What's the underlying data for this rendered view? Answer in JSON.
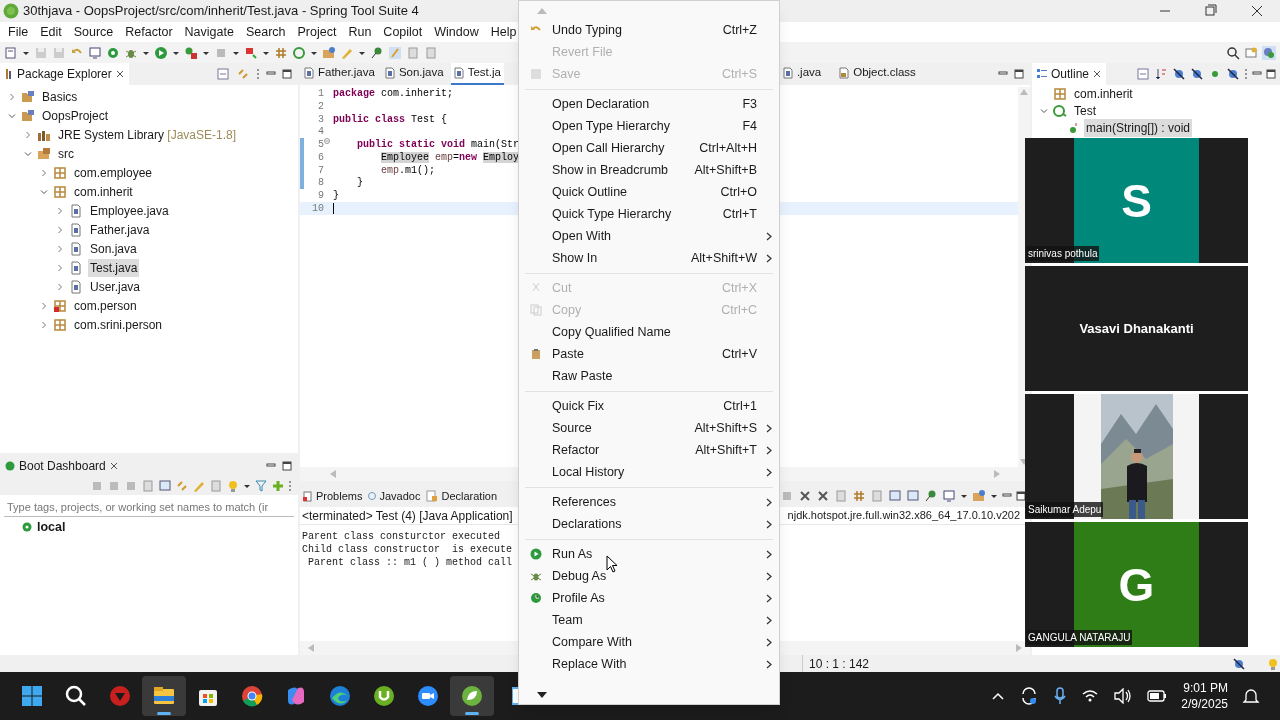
{
  "window": {
    "title": "30thjava - OopsProject/src/com/inherit/Test.java - Spring Tool Suite 4"
  },
  "menu_bar": [
    "File",
    "Edit",
    "Source",
    "Refactor",
    "Navigate",
    "Search",
    "Project",
    "Run",
    "Copilot",
    "Window",
    "Help"
  ],
  "package_explorer": {
    "title": "Package Explorer",
    "tree": [
      {
        "label": "Basics",
        "kind": "project",
        "expanded": false,
        "selected": false
      },
      {
        "label": "OopsProject",
        "kind": "project",
        "expanded": true,
        "selected": false,
        "children": [
          {
            "label": "JRE System Library",
            "decoration": "[JavaSE-1.8]",
            "kind": "library",
            "expanded": false,
            "selected": false
          },
          {
            "label": "src",
            "kind": "source_folder",
            "expanded": true,
            "selected": false,
            "children": [
              {
                "label": "com.employee",
                "kind": "package",
                "expanded": false,
                "selected": false
              },
              {
                "label": "com.inherit",
                "kind": "package",
                "expanded": true,
                "selected": false,
                "children": [
                  {
                    "label": "Employee.java",
                    "kind": "java_file",
                    "expanded": false,
                    "selected": false
                  },
                  {
                    "label": "Father.java",
                    "kind": "java_file",
                    "expanded": false,
                    "selected": false
                  },
                  {
                    "label": "Son.java",
                    "kind": "java_file",
                    "expanded": false,
                    "selected": false
                  },
                  {
                    "label": "Test.java",
                    "kind": "java_file",
                    "expanded": false,
                    "selected": true
                  },
                  {
                    "label": "User.java",
                    "kind": "java_file",
                    "expanded": false,
                    "selected": false
                  }
                ]
              },
              {
                "label": "com.person",
                "kind": "package_error",
                "expanded": false,
                "selected": false
              },
              {
                "label": "com.srini.person",
                "kind": "package",
                "expanded": false,
                "selected": false
              }
            ]
          }
        ]
      }
    ]
  },
  "editor": {
    "tabs_left": [
      {
        "label": "Father.java",
        "selected": false
      },
      {
        "label": "Son.java",
        "selected": false
      },
      {
        "label": "Test.ja",
        "selected": true
      }
    ],
    "tabs_right": [
      {
        "label": ".java",
        "kind": "java",
        "selected": false
      },
      {
        "label": "Object.class",
        "kind": "class",
        "selected": false
      }
    ],
    "lines": [
      {
        "number": "1",
        "changed": false,
        "current": false,
        "fold": false,
        "tokens": [
          {
            "kind": "keyword",
            "text": "package"
          },
          {
            "kind": "plain",
            "text": " com.inherit;"
          }
        ]
      },
      {
        "number": "2",
        "changed": false,
        "current": false,
        "fold": false
      },
      {
        "number": "3",
        "changed": false,
        "current": false,
        "fold": false,
        "tokens": [
          {
            "kind": "keyword",
            "text": "public"
          },
          {
            "kind": "keyword",
            "text": " class"
          },
          {
            "kind": "plain",
            "text": " Test {"
          }
        ]
      },
      {
        "number": "4",
        "changed": false,
        "current": false,
        "fold": false
      },
      {
        "number": "5",
        "changed": true,
        "current": false,
        "fold": true,
        "tokens": [
          {
            "kind": "keyword",
            "text": "    public"
          },
          {
            "kind": "keyword",
            "text": " static"
          },
          {
            "kind": "keyword",
            "text": " void"
          },
          {
            "kind": "plain",
            "text": " main(Str"
          }
        ]
      },
      {
        "number": "6",
        "changed": true,
        "current": false,
        "fold": false,
        "tokens": [
          {
            "kind": "highlight",
            "text": "        Employee"
          },
          {
            "kind": "var",
            "text": " emp"
          },
          {
            "kind": "plain",
            "text": "="
          },
          {
            "kind": "keyword",
            "text": "new"
          },
          {
            "kind": "highlight",
            "text": " Employ"
          }
        ]
      },
      {
        "number": "7",
        "changed": true,
        "current": false,
        "fold": false,
        "tokens": [
          {
            "kind": "var",
            "text": "        emp"
          },
          {
            "kind": "plain",
            "text": ".m1();"
          }
        ]
      },
      {
        "number": "8",
        "changed": true,
        "current": false,
        "fold": false,
        "tokens": [
          {
            "kind": "plain",
            "text": "    }"
          }
        ]
      },
      {
        "number": "9",
        "changed": false,
        "current": false,
        "fold": false,
        "tokens": [
          {
            "kind": "plain",
            "text": "}"
          }
        ]
      },
      {
        "number": "10",
        "changed": false,
        "current": true,
        "fold": false
      }
    ]
  },
  "boot_dashboard": {
    "title": "Boot Dashboard",
    "filter_placeholder": "Type tags, projects, or working set names to match (ir",
    "items": [
      {
        "label": "local"
      }
    ]
  },
  "console": {
    "tabs": [
      {
        "label": "Problems",
        "kind": "problems"
      },
      {
        "label": "Javadoc",
        "kind": "javadoc"
      },
      {
        "label": "Declaration",
        "kind": "declaration"
      }
    ],
    "status": "<terminated> Test (4) [Java Application]",
    "jre": "njdk.hotspot.jre.full.win32.x86_64_17.0.10.v202",
    "output": [
      "Parent class consturctor executed",
      "Child class constructor  is execute",
      " Parent class :: m1 ( ) method call"
    ]
  },
  "outline": {
    "title": "Outline",
    "tree": [
      {
        "label": "com.inherit",
        "kind": "package",
        "selected": false
      },
      {
        "label": "Test",
        "kind": "class",
        "expanded": true,
        "selected": false,
        "children": [
          {
            "label": "main(String[]) : void",
            "kind": "method",
            "selected": true
          }
        ]
      }
    ]
  },
  "status_bar": {
    "position": "10 : 1 : 142"
  },
  "context_menu": {
    "items": [
      {
        "kind": "undo",
        "label": "Undo Typing",
        "shortcut": "Ctrl+Z",
        "disabled": false,
        "submenu": false
      },
      {
        "kind": "item",
        "label": "Revert File",
        "disabled": true,
        "submenu": false
      },
      {
        "kind": "save",
        "label": "Save",
        "shortcut": "Ctrl+S",
        "disabled": true,
        "submenu": false
      },
      {
        "kind": "separator"
      },
      {
        "kind": "item",
        "label": "Open Declaration",
        "shortcut": "F3",
        "disabled": false,
        "submenu": false
      },
      {
        "kind": "item",
        "label": "Open Type Hierarchy",
        "shortcut": "F4",
        "disabled": false,
        "submenu": false
      },
      {
        "kind": "item",
        "label": "Open Call Hierarchy",
        "shortcut": "Ctrl+Alt+H",
        "disabled": false,
        "submenu": false
      },
      {
        "kind": "item",
        "label": "Show in Breadcrumb",
        "shortcut": "Alt+Shift+B",
        "disabled": false,
        "submenu": false
      },
      {
        "kind": "item",
        "label": "Quick Outline",
        "shortcut": "Ctrl+O",
        "disabled": false,
        "submenu": false
      },
      {
        "kind": "item",
        "label": "Quick Type Hierarchy",
        "shortcut": "Ctrl+T",
        "disabled": false,
        "submenu": false
      },
      {
        "kind": "item",
        "label": "Open With",
        "disabled": false,
        "submenu": true
      },
      {
        "kind": "item",
        "label": "Show In",
        "shortcut": "Alt+Shift+W",
        "disabled": false,
        "submenu": true
      },
      {
        "kind": "separator"
      },
      {
        "kind": "cut",
        "label": "Cut",
        "shortcut": "Ctrl+X",
        "disabled": true,
        "submenu": false
      },
      {
        "kind": "copy",
        "label": "Copy",
        "shortcut": "Ctrl+C",
        "disabled": true,
        "submenu": false
      },
      {
        "kind": "item",
        "label": "Copy Qualified Name",
        "disabled": false,
        "submenu": false
      },
      {
        "kind": "paste",
        "label": "Paste",
        "shortcut": "Ctrl+V",
        "disabled": false,
        "submenu": false
      },
      {
        "kind": "item",
        "label": "Raw Paste",
        "disabled": false,
        "submenu": false
      },
      {
        "kind": "separator"
      },
      {
        "kind": "item",
        "label": "Quick Fix",
        "shortcut": "Ctrl+1",
        "disabled": false,
        "submenu": false
      },
      {
        "kind": "item",
        "label": "Source",
        "shortcut": "Alt+Shift+S",
        "disabled": false,
        "submenu": true
      },
      {
        "kind": "item",
        "label": "Refactor",
        "shortcut": "Alt+Shift+T",
        "disabled": false,
        "submenu": true
      },
      {
        "kind": "item",
        "label": "Local History",
        "disabled": false,
        "submenu": true
      },
      {
        "kind": "separator"
      },
      {
        "kind": "item",
        "label": "References",
        "disabled": false,
        "submenu": true
      },
      {
        "kind": "item",
        "label": "Declarations",
        "disabled": false,
        "submenu": true
      },
      {
        "kind": "separator"
      },
      {
        "kind": "run",
        "label": "Run As",
        "disabled": false,
        "submenu": true
      },
      {
        "kind": "debug",
        "label": "Debug As",
        "disabled": false,
        "submenu": true
      },
      {
        "kind": "profile",
        "label": "Profile As",
        "disabled": false,
        "submenu": true
      },
      {
        "kind": "item",
        "label": "Team",
        "disabled": false,
        "submenu": true
      },
      {
        "kind": "item",
        "label": "Compare With",
        "disabled": false,
        "submenu": true
      },
      {
        "kind": "item",
        "label": "Replace With",
        "disabled": false,
        "submenu": true
      }
    ]
  },
  "participants": [
    {
      "name": "srinivas pothula",
      "kind": "initial",
      "initial": "S",
      "color": "#00897b"
    },
    {
      "name": "Vasavi Dhanakanti",
      "kind": "name_only"
    },
    {
      "name": "Saikumar Adepu",
      "kind": "picture"
    },
    {
      "name": "GANGULA NATARAJU",
      "kind": "initial",
      "initial": "G",
      "color": "#2e7d16"
    }
  ],
  "taskbar": {
    "apps": [
      {
        "kind": "start",
        "selected": false
      },
      {
        "kind": "search",
        "selected": false
      },
      {
        "kind": "shield",
        "selected": false
      },
      {
        "kind": "folder",
        "selected": true
      },
      {
        "kind": "store",
        "selected": false
      },
      {
        "kind": "chrome",
        "selected": false
      },
      {
        "kind": "copilot",
        "selected": false
      },
      {
        "kind": "edge",
        "selected": false
      },
      {
        "kind": "torrent",
        "selected": false
      },
      {
        "kind": "zoom",
        "selected": false
      },
      {
        "kind": "spring",
        "selected": true
      },
      {
        "kind": "notepad",
        "selected": false
      }
    ],
    "clock": {
      "time": "9:01 PM",
      "date": "2/9/2025"
    }
  }
}
